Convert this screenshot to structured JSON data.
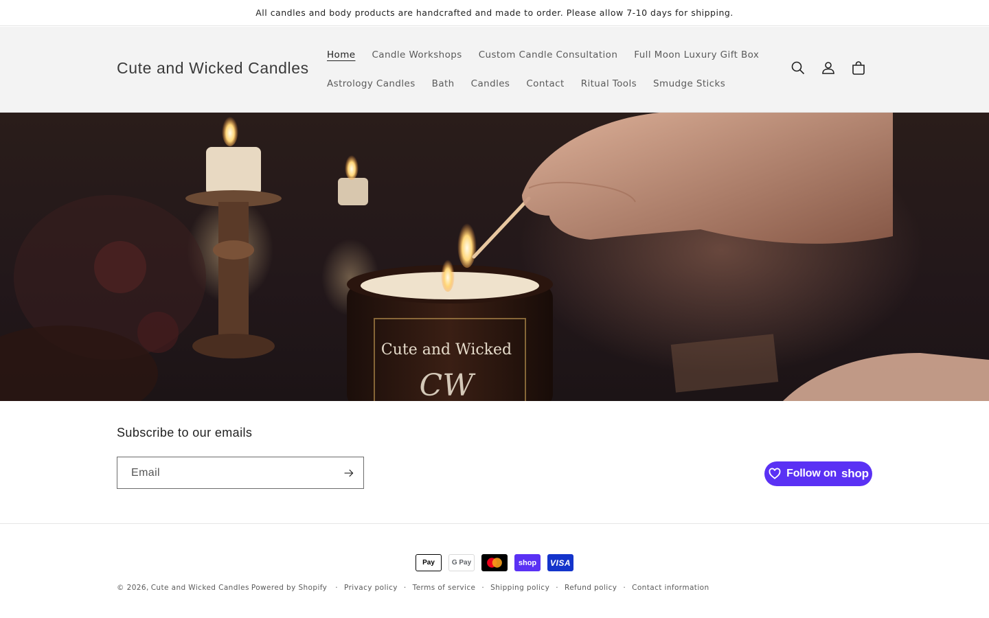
{
  "announcement": {
    "text": "All candles and body products are handcrafted and made to order. Please allow 7-10 days for shipping."
  },
  "header": {
    "logo": "Cute and Wicked Candles",
    "nav_row1": [
      "Home",
      "Candle Workshops",
      "Custom Candle Consultation",
      "Full Moon Luxury Gift Box"
    ],
    "nav_row2": [
      "Astrology Candles",
      "Bath",
      "Candles",
      "Contact",
      "Ritual Tools",
      "Smudge Sticks"
    ],
    "active_nav": "Home",
    "icons": [
      "search-icon",
      "account-icon",
      "cart-icon"
    ]
  },
  "hero": {
    "jar_label": "Cute and Wicked",
    "jar_label_script": "CW"
  },
  "newsletter": {
    "title": "Subscribe to our emails",
    "email_placeholder": "Email",
    "submit_icon": "arrow-right-icon"
  },
  "follow_shop": {
    "label": "Follow on",
    "brand": "shop",
    "icon": "heart-icon",
    "color": "#5a31f4"
  },
  "payments": [
    {
      "name": "Apple Pay",
      "text": "Pay"
    },
    {
      "name": "Google Pay",
      "text": "G Pay"
    },
    {
      "name": "Mastercard",
      "text": ""
    },
    {
      "name": "Shop Pay",
      "text": "shop"
    },
    {
      "name": "Visa",
      "text": "VISA"
    }
  ],
  "footer": {
    "copyright_prefix": "© 2026,",
    "store_name": "Cute and Wicked Candles",
    "powered_by": "Powered by Shopify",
    "links": [
      "Privacy policy",
      "Terms of service",
      "Shipping policy",
      "Refund policy",
      "Contact information"
    ]
  }
}
